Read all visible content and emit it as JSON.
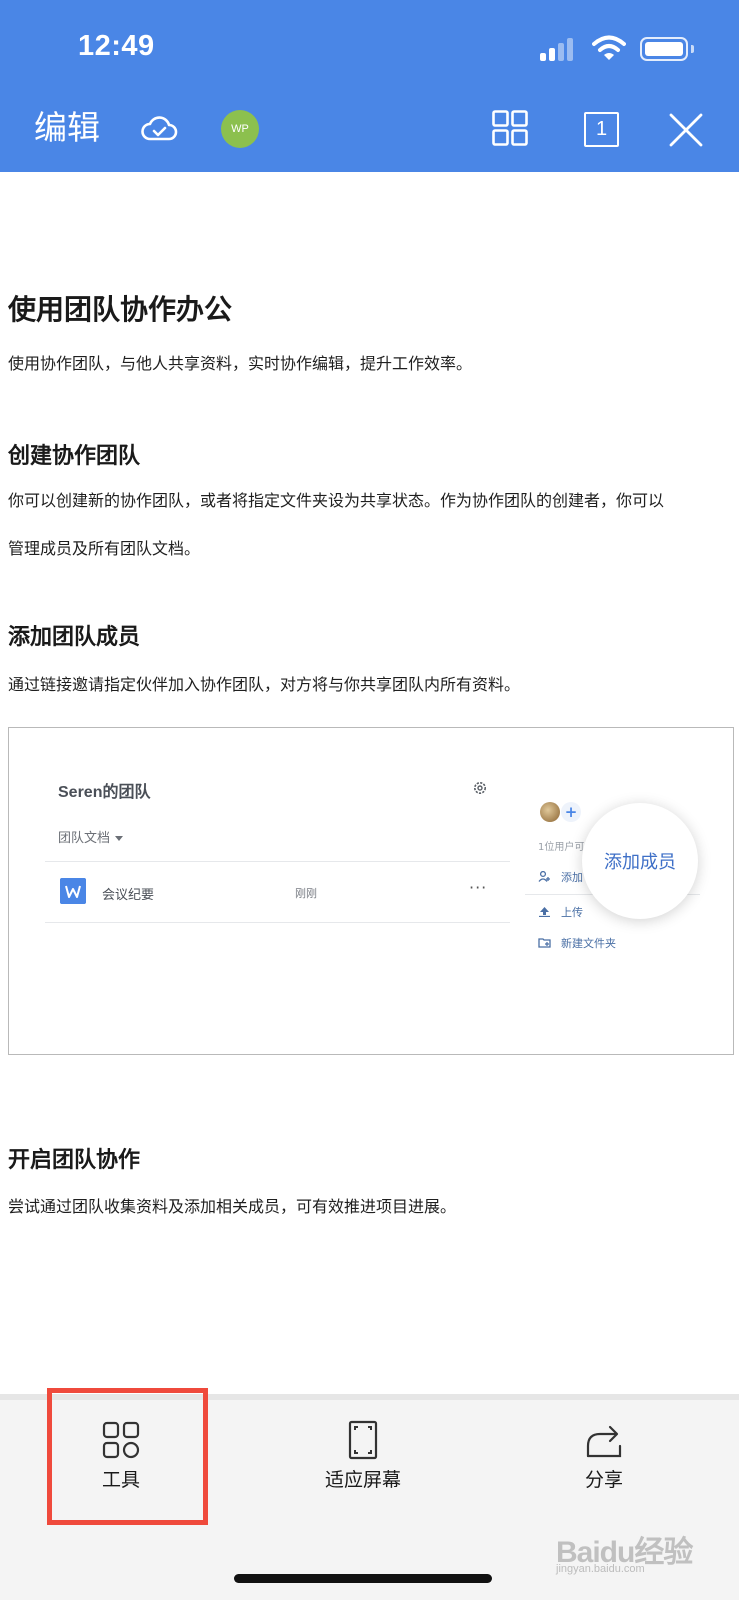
{
  "status_bar": {
    "time": "12:49"
  },
  "header": {
    "edit_label": "编辑",
    "collaborator_initials": "WP",
    "page_count": "1",
    "icons": [
      "cloud-sync-icon",
      "avatar",
      "grid-view-icon",
      "page-count-icon",
      "close-icon"
    ],
    "bar_color": "#4a86e6"
  },
  "document": {
    "title": "使用团队协作办公",
    "intro": "使用协作团队，与他人共享资料，实时协作编辑，提升工作效率。",
    "sections": [
      {
        "heading": "创建协作团队",
        "body_line1": "你可以创建新的协作团队，或者将指定文件夹设为共享状态。作为协作团队的创建者，你可以",
        "body_line2": "管理成员及所有团队文档。"
      },
      {
        "heading": "添加团队成员",
        "body_line1": "通过链接邀请指定伙伴加入协作团队，对方将与你共享团队内所有资料。"
      },
      {
        "heading": "开启团队协作",
        "body_line1": "尝试通过团队收集资料及添加相关成员，可有效推进项目进展。"
      }
    ],
    "embedded_image": {
      "team_name": "Seren的团队",
      "team_docs_label": "团队文档",
      "doc_row": {
        "name": "会议纪要",
        "time": "刚刚",
        "more": "···"
      },
      "user_count": "1位用户可",
      "side_actions": [
        "添加",
        "上传",
        "新建文件夹"
      ],
      "bubble_label": "添加成员"
    }
  },
  "toolbar": {
    "items": [
      {
        "label": "工具",
        "icon": "tools-icon"
      },
      {
        "label": "适应屏幕",
        "icon": "fit-screen-icon"
      },
      {
        "label": "分享",
        "icon": "share-icon"
      }
    ],
    "highlight_color": "#ef4a3c"
  },
  "watermark": {
    "text": "Baidu经验",
    "sub": "jingyan.baidu.com"
  }
}
